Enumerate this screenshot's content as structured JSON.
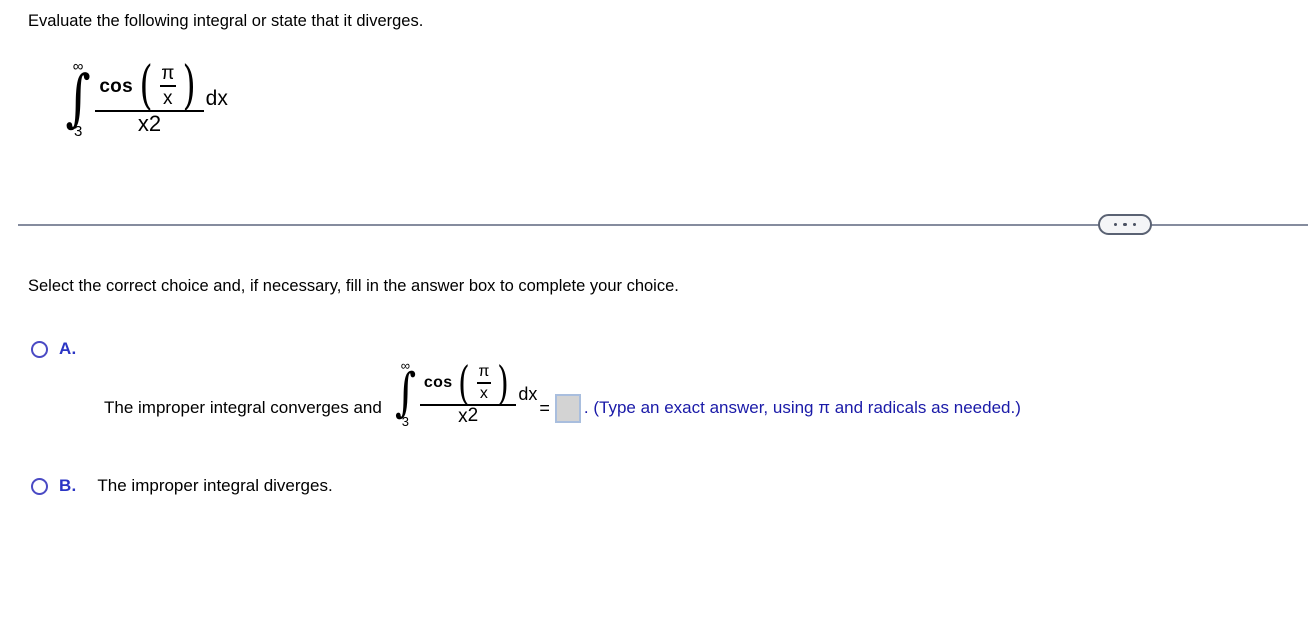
{
  "prompt": {
    "text": "Evaluate the following integral or state that it diverges."
  },
  "main_integral": {
    "upper_limit": "∞",
    "lower_limit": "3",
    "integral_glyph": "∫",
    "function_name": "cos",
    "left_paren": "(",
    "right_paren": ")",
    "inner_numerator": "π",
    "inner_denominator": "x",
    "denominator_base": "x",
    "denominator_exponent": "2",
    "differential": "dx"
  },
  "divider": {
    "ellipsis_label": "...",
    "dot_color": "#4b5263",
    "line_color": "#858c9e"
  },
  "instruction": {
    "text": "Select the correct choice and, if necessary, fill in the answer box to complete your choice."
  },
  "choices": {
    "accent_color": "#2b35c4",
    "radio_border_color": "#4a4ac4",
    "option_a": {
      "letter": "A.",
      "lead_text": "The improper integral converges and",
      "integral": {
        "upper_limit": "∞",
        "lower_limit": "3",
        "integral_glyph": "∫",
        "function_name": "cos",
        "left_paren": "(",
        "right_paren": ")",
        "inner_numerator": "π",
        "inner_denominator": "x",
        "denominator_base": "x",
        "denominator_exponent": "2",
        "differential": "dx"
      },
      "equals": "=",
      "answer_value": "",
      "hint": ". (Type an exact answer, using π and radicals as needed.)",
      "answer_box_fill": "#d3d3d3",
      "answer_box_border": "#a9bede",
      "hint_color": "#1a1aa8"
    },
    "option_b": {
      "letter": "B.",
      "text": "The improper integral diverges."
    }
  }
}
